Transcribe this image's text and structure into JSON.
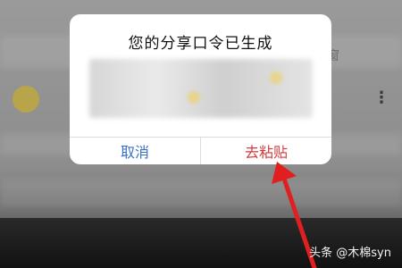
{
  "dialog": {
    "title": "您的分享口令已生成",
    "cancel_label": "取消",
    "paste_label": "去粘贴"
  },
  "background": {
    "partial_char": "窗"
  },
  "watermark": "头条 @木棉syn"
}
